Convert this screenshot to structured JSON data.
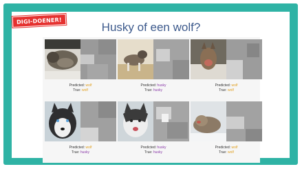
{
  "badge": {
    "label": "DIGI-DOENER!"
  },
  "title": "Husky of een wolf?",
  "captions": {
    "predicted_label": "Predicted:",
    "true_label": "True:"
  },
  "items": [
    {
      "predicted": "wolf",
      "true": "wolf"
    },
    {
      "predicted": "husky",
      "true": "husky"
    },
    {
      "predicted": "wolf",
      "true": "wolf"
    },
    {
      "predicted": "wolf",
      "true": "husky"
    },
    {
      "predicted": "husky",
      "true": "husky"
    },
    {
      "predicted": "wolf",
      "true": "wolf"
    }
  ],
  "colors": {
    "frame": "#2fb3a5",
    "badge": "#e5312f",
    "title": "#3d5a8c",
    "wolf_label": "#e0a020",
    "husky_label": "#8a3aa8"
  }
}
